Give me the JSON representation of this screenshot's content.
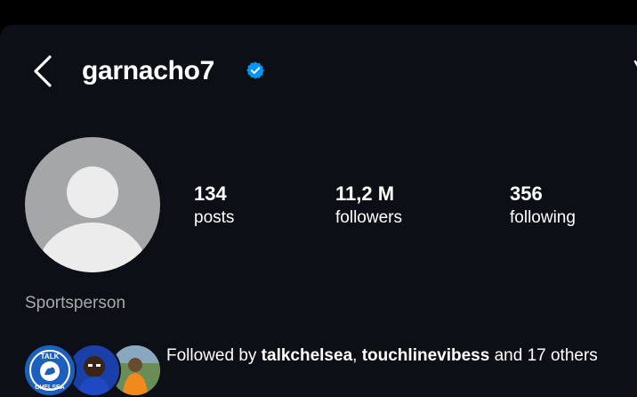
{
  "profile": {
    "username": "garnacho7",
    "verified": true,
    "category": "Sportsperson"
  },
  "stats": [
    {
      "value": "134",
      "label": "posts"
    },
    {
      "value": "11,2 M",
      "label": "followers"
    },
    {
      "value": "356",
      "label": "following"
    }
  ],
  "followed_by": {
    "prefix": "Followed by ",
    "user1": "talkchelsea",
    "separator": ", ",
    "user2": "touchlinevibess",
    "suffix": " and 17 others",
    "badge_text": [
      "TALK",
      "CHELSEA"
    ]
  },
  "colors": {
    "background": "#0c1016",
    "verified": "#0095f6",
    "avatar_placeholder": "#a5a6a8",
    "muted_text": "#a8a8a8"
  },
  "icons": [
    "back-chevron-icon",
    "verified-badge-icon"
  ]
}
